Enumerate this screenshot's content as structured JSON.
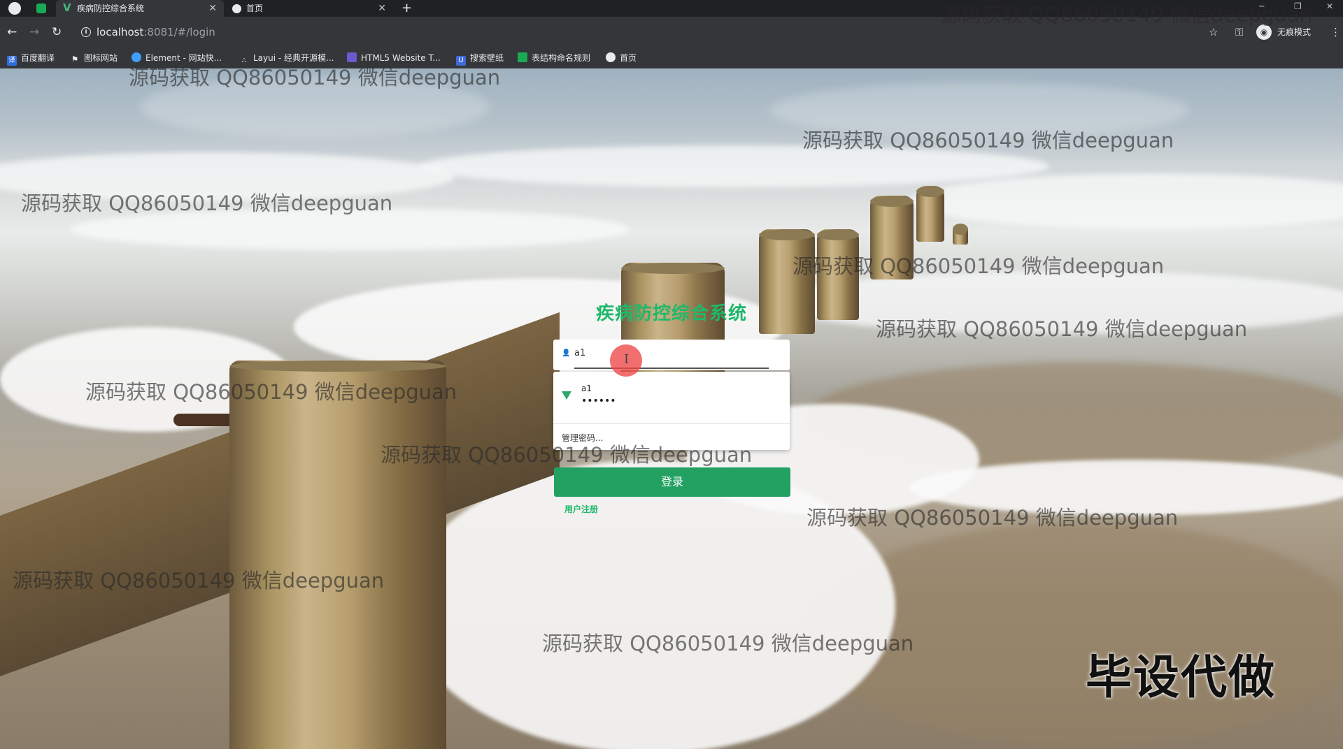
{
  "browser": {
    "tabs": [
      {
        "title": "疾病防控综合系统",
        "active": true
      },
      {
        "title": "首页",
        "active": false
      }
    ],
    "address": {
      "host": "localhost",
      "path": ":8081/#/login"
    },
    "incognito_label": "无痕模式",
    "bookmarks": [
      {
        "label": "百度翻译",
        "icon": "baidu-translate-icon",
        "color": "#2f6de1"
      },
      {
        "label": "图标网站",
        "icon": "flag-icon",
        "color": "#cccccc"
      },
      {
        "label": "Element - 网站快...",
        "icon": "element-icon",
        "color": "#409eff"
      },
      {
        "label": "Layui - 经典开源模...",
        "icon": "layui-icon",
        "color": "#999999"
      },
      {
        "label": "HTML5 Website T...",
        "icon": "html5-icon",
        "color": "#6a5acd"
      },
      {
        "label": "搜索壁纸",
        "icon": "wallpaper-icon",
        "color": "#3f6ad8"
      },
      {
        "label": "表结构命名规则",
        "icon": "sheet-icon",
        "color": "#1aaa55"
      },
      {
        "label": "首页",
        "icon": "globe-icon",
        "color": "#cccccc"
      }
    ]
  },
  "login": {
    "title": "疾病防控综合系统",
    "username_value": "a1",
    "autofill": {
      "username": "a1",
      "password_mask": "••••••",
      "manage_label": "管理密码..."
    },
    "login_button": "登录",
    "register_link": "用户注册"
  },
  "overlay": {
    "watermark_text": "源码获取 QQ86050149 微信deepguan",
    "stamp_text": "毕设代做"
  },
  "colors": {
    "accent": "#1fb86a",
    "button": "#23a162"
  }
}
